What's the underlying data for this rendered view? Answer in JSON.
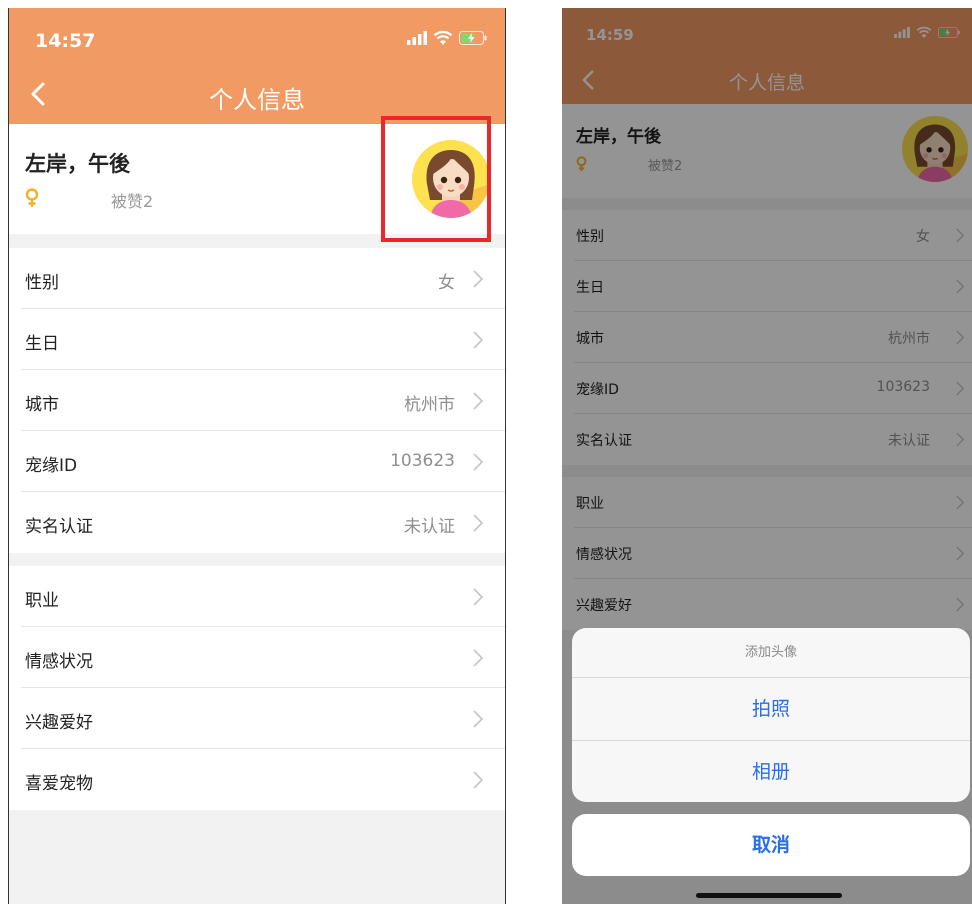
{
  "colors": {
    "header": "#f19a64",
    "highlight": "#e8282c",
    "action_blue": "#2a6ee8",
    "gender": "#f3b22d",
    "avatar_bg": "#fde14f"
  },
  "left": {
    "time": "14:57",
    "title": "个人信息",
    "profile": {
      "name": "左岸，午後",
      "likes": "被赞2"
    },
    "rows": [
      {
        "label": "性别",
        "value": "女"
      },
      {
        "label": "生日",
        "value": ""
      },
      {
        "label": "城市",
        "value": "杭州市"
      },
      {
        "label": "宠缘ID",
        "value": "103623"
      },
      {
        "label": "实名认证",
        "value": "未认证"
      },
      {
        "label": "职业",
        "value": ""
      },
      {
        "label": "情感状况",
        "value": ""
      },
      {
        "label": "兴趣爱好",
        "value": ""
      },
      {
        "label": "喜爱宠物",
        "value": ""
      }
    ]
  },
  "right": {
    "time": "14:59",
    "title": "个人信息",
    "profile": {
      "name": "左岸，午後",
      "likes": "被赞2"
    },
    "rows": [
      {
        "label": "性别",
        "value": "女"
      },
      {
        "label": "生日",
        "value": ""
      },
      {
        "label": "城市",
        "value": "杭州市"
      },
      {
        "label": "宠缘ID",
        "value": "103623"
      },
      {
        "label": "实名认证",
        "value": "未认证"
      },
      {
        "label": "职业",
        "value": ""
      },
      {
        "label": "情感状况",
        "value": ""
      },
      {
        "label": "兴趣爱好",
        "value": ""
      }
    ],
    "action_sheet": {
      "title": "添加头像",
      "options": [
        "拍照",
        "相册"
      ],
      "cancel": "取消"
    }
  }
}
